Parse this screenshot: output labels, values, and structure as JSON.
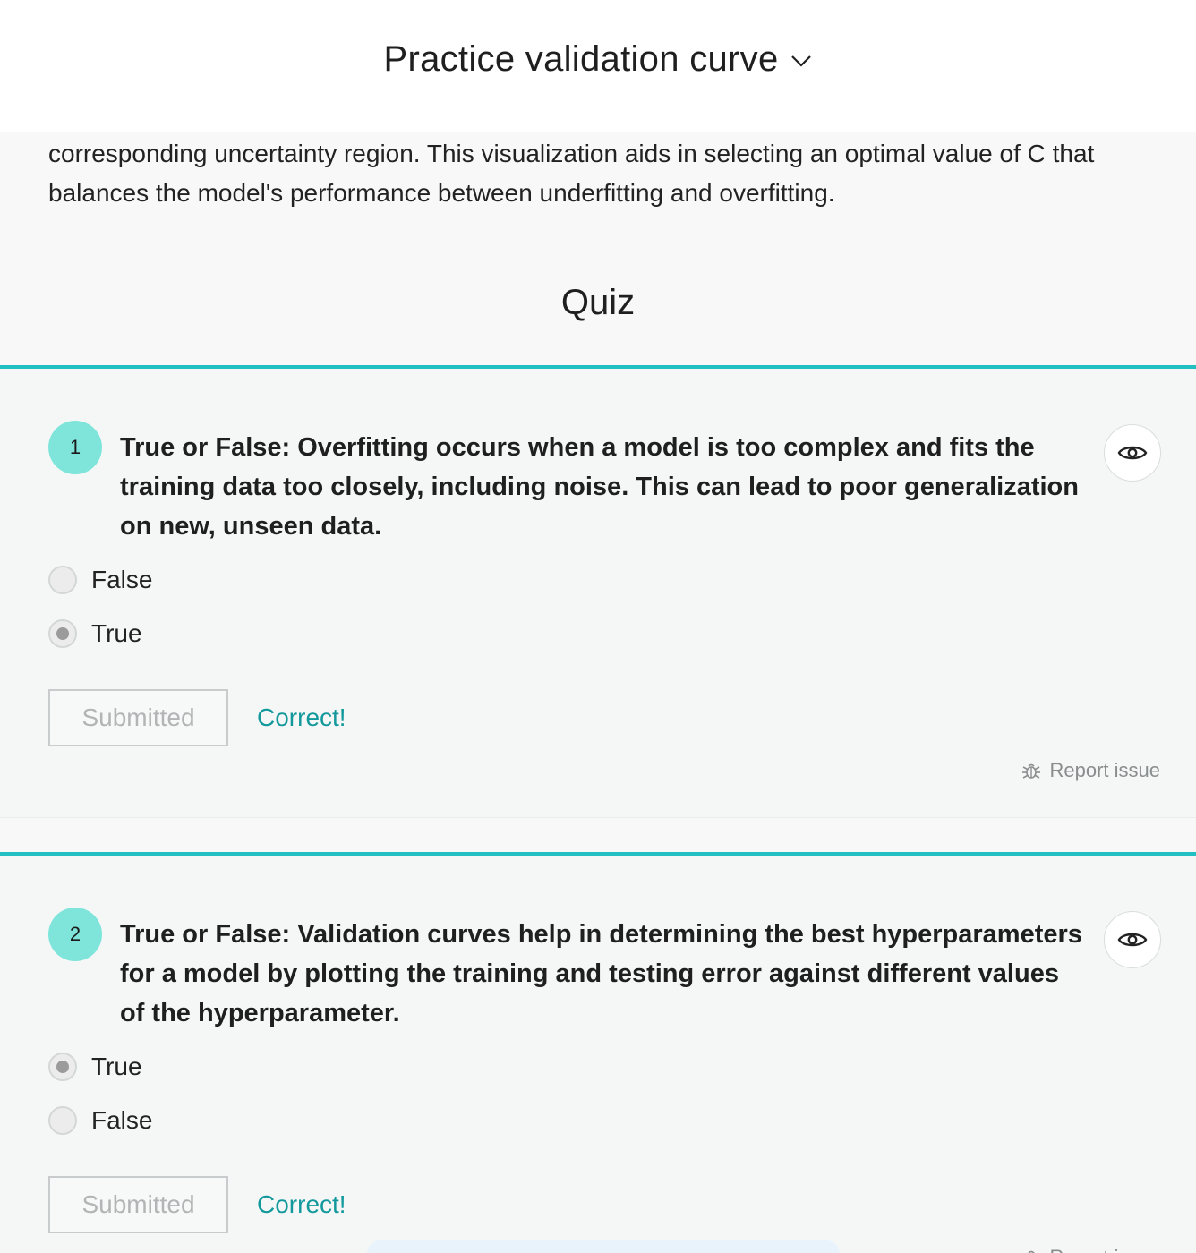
{
  "header": {
    "title": "Practice validation curve"
  },
  "intro": {
    "text": "corresponding uncertainty region. This visualization aids in selecting an optimal value of C that balances the model's performance between underfitting and overfitting."
  },
  "quiz": {
    "heading": "Quiz",
    "questions": [
      {
        "number": "1",
        "text": "True or False: Overfitting occurs when a model is too complex and fits the training data too closely, including noise. This can lead to poor generalization on new, unseen data.",
        "options": [
          {
            "label": "False",
            "selected": false
          },
          {
            "label": "True",
            "selected": true
          }
        ],
        "submit_label": "Submitted",
        "feedback": "Correct!",
        "report_label": "Report issue"
      },
      {
        "number": "2",
        "text": "True or False: Validation curves help in determining the best hyperparameters for a model by plotting the training and testing error against different values of the hyperparameter.",
        "options": [
          {
            "label": "True",
            "selected": true
          },
          {
            "label": "False",
            "selected": false
          }
        ],
        "submit_label": "Submitted",
        "feedback": "Correct!",
        "report_label": "Report issue"
      }
    ]
  },
  "colors": {
    "accent": "#22bfc3",
    "number_badge": "#7fe5db",
    "correct_text": "#13999c"
  },
  "icons": {
    "dropdown": "chevron-down-icon",
    "reveal": "eye-icon",
    "report": "bug-icon"
  }
}
